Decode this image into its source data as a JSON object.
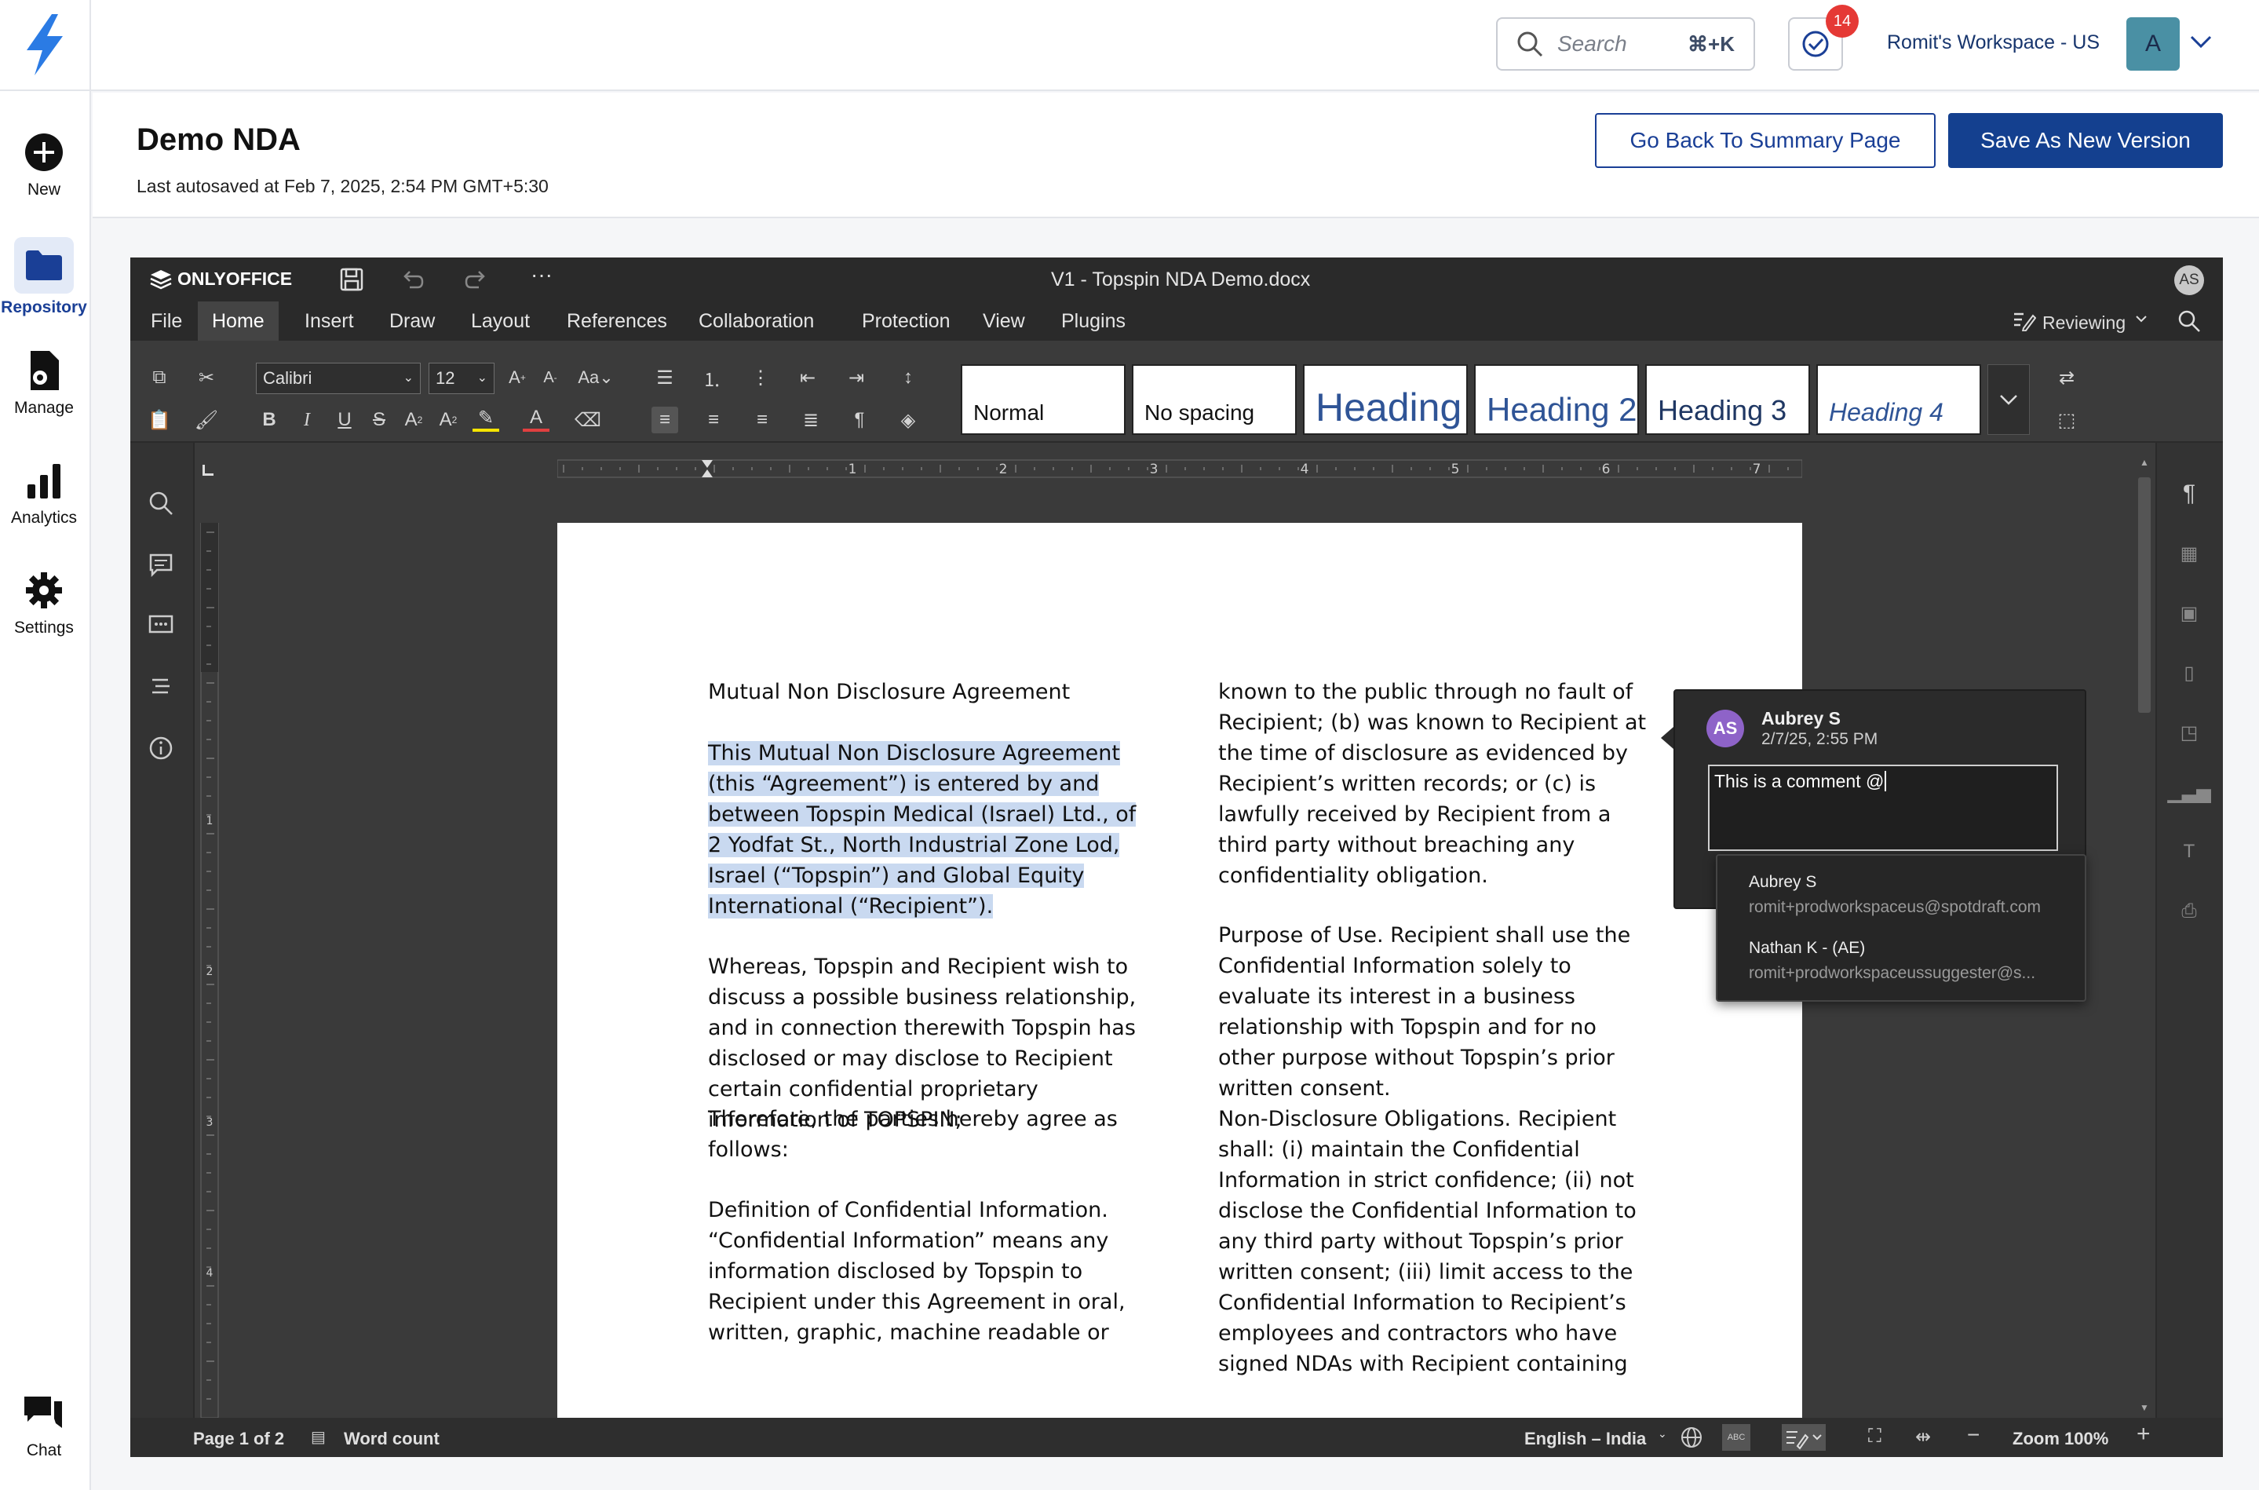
{
  "app": {
    "search": {
      "placeholder": "Search",
      "shortcut": "⌘+K"
    },
    "tasks_badge": "14",
    "workspace": {
      "name": "Romit's Workspace - US",
      "avatar": "A"
    },
    "accent": "#14408f"
  },
  "nav": {
    "new": "New",
    "repository": "Repository",
    "manage": "Manage",
    "analytics": "Analytics",
    "settings": "Settings",
    "chat": "Chat"
  },
  "header": {
    "title": "Demo NDA",
    "autosave": "Last autosaved at Feb 7, 2025, 2:54 PM GMT+5:30",
    "back_button": "Go Back To Summary Page",
    "save_button": "Save As New Version"
  },
  "editor": {
    "brand": "ONLYOFFICE",
    "file_title": "V1 - Topspin NDA Demo.docx",
    "user_initials": "AS",
    "tabs": [
      "File",
      "Home",
      "Insert",
      "Draw",
      "Layout",
      "References",
      "Collaboration",
      "Protection",
      "View",
      "Plugins"
    ],
    "mode": "Reviewing",
    "font_name": "Calibri",
    "font_size": "12",
    "styles": [
      "Normal",
      "No spacing",
      "Heading 1",
      "Heading 2",
      "Heading 3",
      "Heading 4"
    ],
    "ruler_numbers": [
      "1",
      "2",
      "3",
      "4",
      "5",
      "6",
      "7"
    ],
    "left_ruler_numbers": [
      "1",
      "2",
      "3",
      "4"
    ]
  },
  "document": {
    "col1": [
      "Mutual Non Disclosure Agreement",
      "This Mutual Non Disclosure Agreement (this “Agreement”) is entered by and between Topspin Medical (Israel) Ltd., of 2 Yodfat St., North Industrial Zone Lod, Israel (“Topspin”) and Global Equity International (“Recipient”).",
      "Whereas, Topspin and Recipient wish to discuss a possible business relationship, and in connection therewith Topspin has disclosed or may disclose to Recipient certain confidential proprietary information of TOPSPIN;",
      "Therefore, the parties hereby agree as follows:",
      "Definition of Confidential Information. “Confidential Information” means any information disclosed by Topspin to Recipient under this Agreement in oral, written, graphic, machine readable or"
    ],
    "col2": [
      "known to the public through no fault of Recipient; (b) was known to Recipient at the time of disclosure as evidenced by Recipient’s written records; or (c) is lawfully received by Recipient from a third party without breaching any confidentiality obligation.",
      "Purpose of Use. Recipient shall use the Confidential Information solely to evaluate its interest in a business relationship with Topspin and for no other purpose without Topspin’s prior written consent.",
      "Non-Disclosure Obligations. Recipient shall: (i) maintain the Confidential Information in strict confidence; (ii) not disclose the Confidential Information to any third party without Topspin’s prior written consent; (iii) limit access to the Confidential Information to Recipient’s employees and contractors who have signed NDAs with Recipient containing"
    ]
  },
  "comment": {
    "initials": "AS",
    "author": "Aubrey S",
    "date": "2/7/25, 2:55 PM",
    "text": "This is a comment @",
    "mentions": [
      {
        "name": "Aubrey S",
        "email": "romit+prodworkspaceus@spotdraft.com"
      },
      {
        "name": "Nathan K - (AE)",
        "email": "romit+prodworkspaceussuggester@s..."
      }
    ]
  },
  "status": {
    "page": "Page 1 of 2",
    "word_count": "Word count",
    "language": "English – India",
    "zoom": "Zoom 100%"
  }
}
